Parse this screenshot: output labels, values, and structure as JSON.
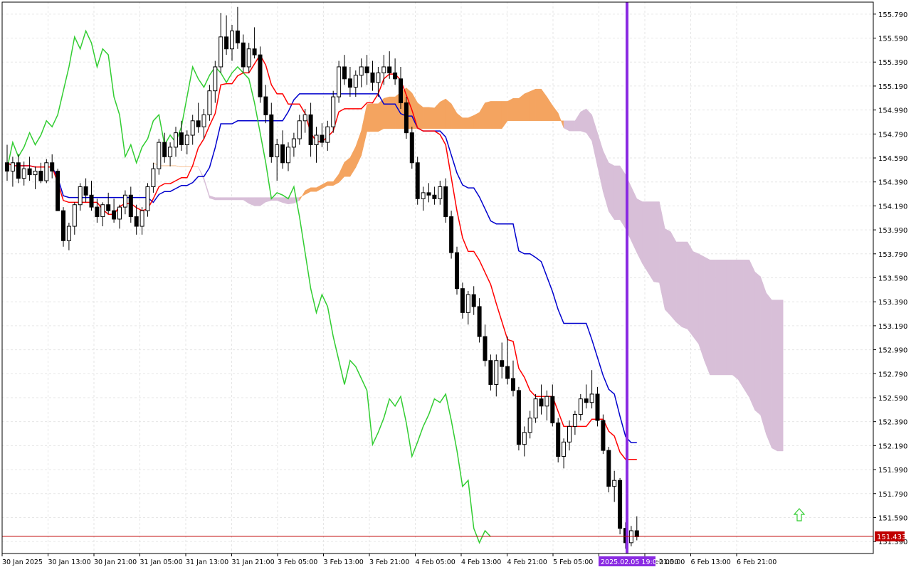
{
  "chart_data": {
    "type": "candlestick",
    "indicator": "Ichimoku Kinko Hyo",
    "grid": true,
    "ylim": [
      151.29,
      155.89
    ],
    "y_ticks": [
      "155.790",
      "155.590",
      "155.390",
      "155.190",
      "154.990",
      "154.790",
      "154.590",
      "154.390",
      "154.190",
      "153.990",
      "153.790",
      "153.590",
      "153.390",
      "153.190",
      "152.990",
      "152.790",
      "152.590",
      "152.390",
      "152.190",
      "151.990",
      "151.790",
      "151.590",
      "151.390"
    ],
    "x_ticks": [
      "30 Jan 2025",
      "30 Jan 13:00",
      "30 Jan 21:00",
      "31 Jan 05:00",
      "31 Jan 13:00",
      "31 Jan 21:00",
      "3 Feb 05:00",
      "3 Feb 13:00",
      "3 Feb 21:00",
      "4 Feb 05:00",
      "4 Feb 13:00",
      "4 Feb 21:00",
      "5 Feb 05:00",
      "5",
      "6 Feb 05:00",
      "6 Feb 13:00",
      "6 Feb 21:00"
    ],
    "x_ticks_partial": [
      "21:00"
    ],
    "current_price": "151.433",
    "cursor_label": "2025.02.05 19:00",
    "candles_ohlc_approx": [
      [
        154.55,
        154.7,
        154.4,
        154.48
      ],
      [
        154.48,
        154.6,
        154.35,
        154.55
      ],
      [
        154.55,
        154.62,
        154.38,
        154.42
      ],
      [
        154.42,
        154.56,
        154.36,
        154.5
      ],
      [
        154.5,
        154.6,
        154.4,
        154.45
      ],
      [
        154.45,
        154.52,
        154.33,
        154.48
      ],
      [
        154.48,
        154.55,
        154.38,
        154.4
      ],
      [
        154.4,
        154.58,
        154.38,
        154.55
      ],
      [
        154.55,
        154.62,
        154.42,
        154.48
      ],
      [
        154.48,
        154.5,
        154.15,
        154.15
      ],
      [
        154.15,
        154.18,
        153.85,
        153.9
      ],
      [
        153.9,
        154.05,
        153.82,
        154.02
      ],
      [
        154.02,
        154.22,
        153.95,
        154.2
      ],
      [
        154.2,
        154.38,
        154.15,
        154.35
      ],
      [
        154.35,
        154.42,
        154.22,
        154.28
      ],
      [
        154.28,
        154.4,
        154.15,
        154.18
      ],
      [
        154.18,
        154.25,
        154.05,
        154.1
      ],
      [
        154.1,
        154.22,
        154.02,
        154.2
      ],
      [
        154.2,
        154.3,
        154.12,
        154.15
      ],
      [
        154.15,
        154.25,
        154.05,
        154.08
      ],
      [
        154.08,
        154.2,
        154.0,
        154.18
      ],
      [
        154.18,
        154.32,
        154.12,
        154.28
      ],
      [
        154.28,
        154.35,
        154.05,
        154.1
      ],
      [
        154.1,
        154.2,
        153.95,
        154.02
      ],
      [
        154.02,
        154.18,
        153.95,
        154.15
      ],
      [
        154.15,
        154.38,
        154.1,
        154.35
      ],
      [
        154.35,
        154.55,
        154.3,
        154.5
      ],
      [
        154.5,
        154.75,
        154.45,
        154.72
      ],
      [
        154.72,
        154.8,
        154.55,
        154.6
      ],
      [
        154.6,
        154.72,
        154.52,
        154.68
      ],
      [
        154.68,
        154.85,
        154.6,
        154.8
      ],
      [
        154.8,
        154.9,
        154.65,
        154.7
      ],
      [
        154.7,
        154.82,
        154.62,
        154.78
      ],
      [
        154.78,
        154.95,
        154.7,
        154.9
      ],
      [
        154.9,
        155.05,
        154.8,
        154.85
      ],
      [
        154.85,
        155.0,
        154.75,
        154.95
      ],
      [
        154.95,
        155.2,
        154.9,
        155.15
      ],
      [
        155.15,
        155.4,
        155.05,
        155.35
      ],
      [
        155.35,
        155.8,
        155.3,
        155.6
      ],
      [
        155.6,
        155.78,
        155.45,
        155.5
      ],
      [
        155.5,
        155.7,
        155.4,
        155.65
      ],
      [
        155.65,
        155.85,
        155.5,
        155.55
      ],
      [
        155.55,
        155.62,
        155.3,
        155.35
      ],
      [
        155.35,
        155.55,
        155.3,
        155.5
      ],
      [
        155.5,
        155.68,
        155.42,
        155.45
      ],
      [
        155.45,
        155.52,
        155.05,
        155.1
      ],
      [
        155.1,
        155.2,
        154.88,
        154.95
      ],
      [
        154.95,
        155.05,
        154.55,
        154.6
      ],
      [
        154.6,
        154.75,
        154.4,
        154.7
      ],
      [
        154.7,
        154.82,
        154.5,
        154.55
      ],
      [
        154.55,
        154.72,
        154.48,
        154.68
      ],
      [
        154.68,
        154.8,
        154.6,
        154.75
      ],
      [
        154.75,
        154.95,
        154.7,
        154.9
      ],
      [
        154.9,
        155.0,
        154.8,
        154.95
      ],
      [
        154.95,
        155.05,
        154.6,
        154.7
      ],
      [
        154.7,
        154.85,
        154.55,
        154.78
      ],
      [
        154.78,
        154.88,
        154.68,
        154.72
      ],
      [
        154.72,
        154.9,
        154.65,
        154.85
      ],
      [
        154.85,
        155.15,
        154.8,
        155.1
      ],
      [
        155.1,
        155.4,
        155.05,
        155.35
      ],
      [
        155.35,
        155.45,
        155.2,
        155.25
      ],
      [
        155.25,
        155.35,
        155.1,
        155.18
      ],
      [
        155.18,
        155.32,
        155.1,
        155.28
      ],
      [
        155.28,
        155.42,
        155.18,
        155.35
      ],
      [
        155.35,
        155.45,
        155.2,
        155.3
      ],
      [
        155.3,
        155.4,
        155.15,
        155.22
      ],
      [
        155.22,
        155.35,
        155.1,
        155.3
      ],
      [
        155.3,
        155.45,
        155.2,
        155.35
      ],
      [
        155.35,
        155.48,
        155.25,
        155.3
      ],
      [
        155.3,
        155.42,
        155.2,
        155.25
      ],
      [
        155.25,
        155.35,
        155.0,
        155.05
      ],
      [
        155.05,
        155.1,
        154.75,
        154.8
      ],
      [
        154.8,
        154.85,
        154.5,
        154.55
      ],
      [
        154.55,
        154.6,
        154.2,
        154.25
      ],
      [
        154.25,
        154.35,
        154.15,
        154.3
      ],
      [
        154.3,
        154.38,
        154.22,
        154.28
      ],
      [
        154.28,
        154.35,
        154.2,
        154.25
      ],
      [
        154.25,
        154.4,
        154.2,
        154.35
      ],
      [
        154.35,
        154.42,
        154.05,
        154.1
      ],
      [
        154.1,
        154.15,
        153.75,
        153.8
      ],
      [
        153.8,
        153.85,
        153.45,
        153.5
      ],
      [
        153.5,
        153.55,
        153.25,
        153.3
      ],
      [
        153.3,
        153.48,
        153.2,
        153.45
      ],
      [
        153.45,
        153.52,
        153.28,
        153.35
      ],
      [
        153.35,
        153.42,
        153.05,
        153.1
      ],
      [
        153.1,
        153.2,
        152.85,
        152.9
      ],
      [
        152.9,
        152.95,
        152.65,
        152.7
      ],
      [
        152.7,
        152.95,
        152.6,
        152.9
      ],
      [
        152.9,
        153.05,
        152.75,
        152.85
      ],
      [
        152.85,
        153.1,
        152.7,
        152.75
      ],
      [
        152.75,
        152.9,
        152.6,
        152.65
      ],
      [
        152.65,
        152.68,
        152.15,
        152.2
      ],
      [
        152.2,
        152.35,
        152.1,
        152.3
      ],
      [
        152.3,
        152.48,
        152.25,
        152.42
      ],
      [
        152.42,
        152.62,
        152.38,
        152.58
      ],
      [
        152.58,
        152.7,
        152.45,
        152.52
      ],
      [
        152.52,
        152.65,
        152.4,
        152.6
      ],
      [
        152.6,
        152.7,
        152.35,
        152.38
      ],
      [
        152.38,
        152.42,
        152.05,
        152.1
      ],
      [
        152.1,
        152.25,
        152.0,
        152.22
      ],
      [
        152.22,
        152.4,
        152.15,
        152.35
      ],
      [
        152.35,
        152.48,
        152.28,
        152.45
      ],
      [
        152.45,
        152.62,
        152.4,
        152.58
      ],
      [
        152.58,
        152.7,
        152.5,
        152.55
      ],
      [
        152.55,
        152.82,
        152.5,
        152.62
      ],
      [
        152.62,
        152.68,
        152.35,
        152.4
      ],
      [
        152.4,
        152.45,
        152.12,
        152.15
      ],
      [
        152.15,
        152.18,
        151.8,
        151.85
      ],
      [
        151.85,
        151.98,
        151.72,
        151.9
      ],
      [
        151.9,
        151.92,
        151.45,
        151.5
      ],
      [
        151.5,
        151.55,
        151.33,
        151.38
      ],
      [
        151.38,
        151.52,
        151.35,
        151.48
      ],
      [
        151.48,
        151.6,
        151.4,
        151.43
      ]
    ]
  },
  "labels": {
    "current_price": "151.433",
    "cursor_label": "2025.02.05 19:00",
    "x_tick_after_cursor": "21:00"
  },
  "colors": {
    "tenkan": "#ff0000",
    "kijun": "#0000cd",
    "chikou": "#32cd32",
    "kumo_up": "#f4a460",
    "kumo_down": "#d8bfd8",
    "cursor": "#8a2be2",
    "price_line": "#c00000",
    "bull_candle": "#ffffff",
    "bear_candle": "#000000",
    "arrow": "#32cd32"
  }
}
